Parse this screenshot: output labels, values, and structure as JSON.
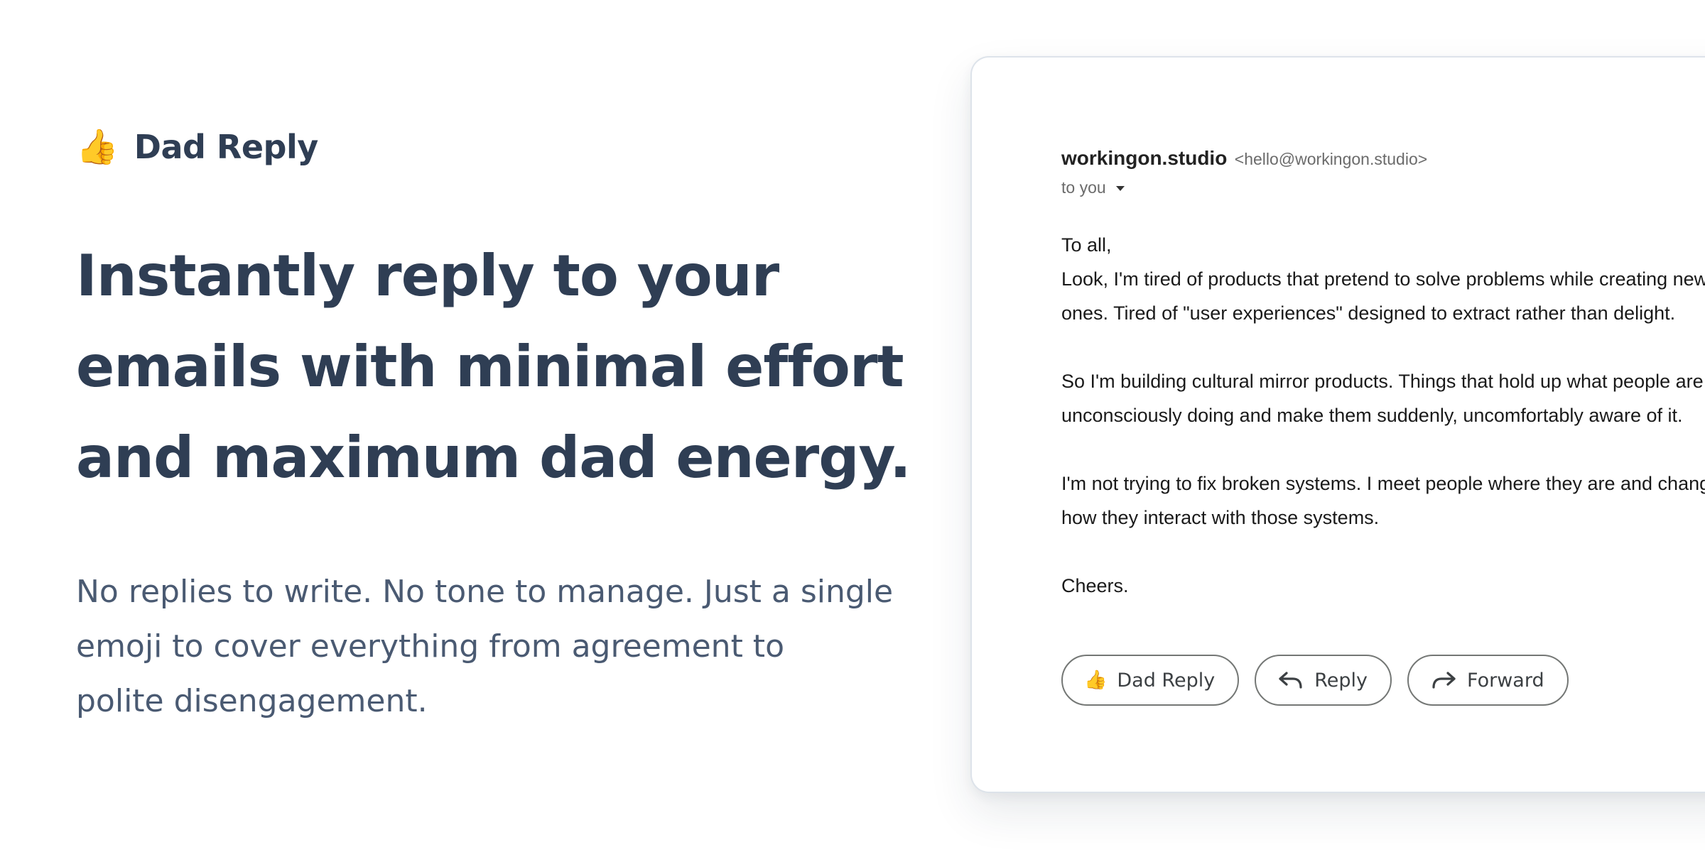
{
  "brand": {
    "emoji": "👍",
    "name": "Dad Reply"
  },
  "hero": {
    "headline_lines": [
      "Instantly reply to your",
      "emails with minimal effort",
      "and maximum dad energy."
    ],
    "subhead_lines": [
      "No replies to write. No tone to manage. Just a single",
      "emoji to cover everything from agreement to",
      "polite disengagement."
    ]
  },
  "email": {
    "sender_name": "workingon.studio",
    "sender_email": "<hello@workingon.studio>",
    "recipient": "to you",
    "greeting": "To all,",
    "paragraph_1": [
      "Look, I'm tired of products that pretend to solve problems while creating new",
      "ones. Tired of \"user experiences\" designed to extract rather than delight."
    ],
    "paragraph_2": [
      "So I'm building cultural mirror products. Things that hold up what people are",
      "unconsciously doing and make them suddenly, uncomfortably aware of it."
    ],
    "paragraph_3": [
      "I'm not trying to fix broken systems. I meet people where they are and change",
      "how they interact with those systems."
    ],
    "signoff": "Cheers."
  },
  "actions": {
    "dad_reply_emoji": "👍",
    "dad_reply_label": "Dad Reply",
    "reply_label": "Reply",
    "forward_label": "Forward"
  },
  "icons": {
    "brand": "thumbs-up-icon",
    "reply": "reply-arrow-icon",
    "forward": "forward-arrow-icon",
    "recipient_dropdown": "caret-down-icon"
  }
}
